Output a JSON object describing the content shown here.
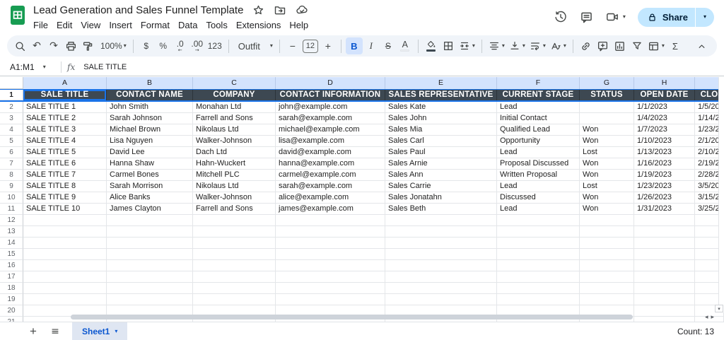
{
  "app": {
    "title": "Lead Generation and Sales Funnel Template",
    "menu": [
      "File",
      "Edit",
      "View",
      "Insert",
      "Format",
      "Data",
      "Tools",
      "Extensions",
      "Help"
    ],
    "share_label": "Share"
  },
  "toolbar": {
    "zoom": "100%",
    "currency": "$",
    "percent": "%",
    "decrease_decimal": ".0",
    "increase_decimal": ".00",
    "number_format": "123",
    "font": "Outfit",
    "decrease_size": "−",
    "font_size": "12",
    "increase_size": "+",
    "bold": "B",
    "italic": "I",
    "strikethrough": "S",
    "text_color": "A",
    "functions": "Σ"
  },
  "formula_bar": {
    "name_box": "A1:M1",
    "fx": "fx",
    "value": "SALE TITLE"
  },
  "sheet": {
    "columns": [
      {
        "letter": "A",
        "label": "SALE TITLE",
        "width": 118
      },
      {
        "letter": "B",
        "label": "CONTACT NAME",
        "width": 122
      },
      {
        "letter": "C",
        "label": "COMPANY",
        "width": 117
      },
      {
        "letter": "D",
        "label": "CONTACT INFORMATION",
        "width": 155
      },
      {
        "letter": "E",
        "label": "SALES REPRESENTATIVE",
        "width": 158
      },
      {
        "letter": "F",
        "label": "CURRENT STAGE",
        "width": 117
      },
      {
        "letter": "G",
        "label": "STATUS",
        "width": 77
      },
      {
        "letter": "H",
        "label": "OPEN DATE",
        "width": 86
      },
      {
        "letter": "",
        "label": "CLO",
        "width": 41
      }
    ],
    "header_row_number": "1",
    "rows": [
      {
        "n": "2",
        "cells": [
          "SALE TITLE 1",
          "John Smith",
          "Monahan Ltd",
          "john@example.com",
          "Sales Kate",
          "Lead",
          "",
          "1/1/2023",
          "1/5/20"
        ]
      },
      {
        "n": "3",
        "cells": [
          "SALE TITLE 2",
          "Sarah Johnson",
          "Farrell and Sons",
          "sarah@example.com",
          "Sales John",
          "Initial Contact",
          "",
          "1/4/2023",
          "1/14/2"
        ]
      },
      {
        "n": "4",
        "cells": [
          "SALE TITLE 3",
          "Michael Brown",
          "Nikolaus Ltd",
          "michael@example.com",
          "Sales Mia",
          "Qualified Lead",
          "Won",
          "1/7/2023",
          "1/23/2"
        ]
      },
      {
        "n": "5",
        "cells": [
          "SALE TITLE 4",
          "Lisa Nguyen",
          "Walker-Johnson",
          "lisa@example.com",
          "Sales Carl",
          "Opportunity",
          "Won",
          "1/10/2023",
          "2/1/20"
        ]
      },
      {
        "n": "6",
        "cells": [
          "SALE TITLE 5",
          "David Lee",
          "Dach Ltd",
          "david@example.com",
          "Sales Paul",
          "Lead",
          "Lost",
          "1/13/2023",
          "2/10/2"
        ]
      },
      {
        "n": "7",
        "cells": [
          "SALE TITLE 6",
          "Hanna Shaw",
          "Hahn-Wuckert",
          "hanna@example.com",
          "Sales Arnie",
          "Proposal Discussed",
          "Won",
          "1/16/2023",
          "2/19/2"
        ]
      },
      {
        "n": "8",
        "cells": [
          "SALE TITLE 7",
          "Carmel Bones",
          "Mitchell PLC",
          "carmel@example.com",
          "Sales Ann",
          "Written Proposal",
          "Won",
          "1/19/2023",
          "2/28/2"
        ]
      },
      {
        "n": "9",
        "cells": [
          "SALE TITLE 8",
          "Sarah Morrison",
          "Nikolaus Ltd",
          "sarah@example.com",
          "Sales Carrie",
          "Lead",
          "Lost",
          "1/23/2023",
          "3/5/20"
        ]
      },
      {
        "n": "10",
        "cells": [
          "SALE TITLE 9",
          "Alice Banks",
          "Walker-Johnson",
          "alice@example.com",
          "Sales Jonatahn",
          "Discussed",
          "Won",
          "1/26/2023",
          "3/15/2"
        ]
      },
      {
        "n": "11",
        "cells": [
          "SALE TITLE 10",
          "James Clayton",
          "Farrell and Sons",
          "james@example.com",
          "Sales Beth",
          "Lead",
          "Won",
          "1/31/2023",
          "3/25/2"
        ]
      }
    ],
    "empty_row_numbers": [
      "12",
      "13",
      "14",
      "15",
      "16",
      "17",
      "18",
      "19",
      "20",
      "21"
    ]
  },
  "bottom": {
    "tab": "Sheet1",
    "count": "Count: 13"
  },
  "colors": {
    "header_row_bg": "#3d4852",
    "selection_blue": "#1a73e8",
    "selected_header_bg": "#d3e3fd",
    "share_button_bg": "#c2e7ff",
    "sheet_tab_text": "#0b57d0",
    "sheets_logo_green": "#179c52"
  }
}
